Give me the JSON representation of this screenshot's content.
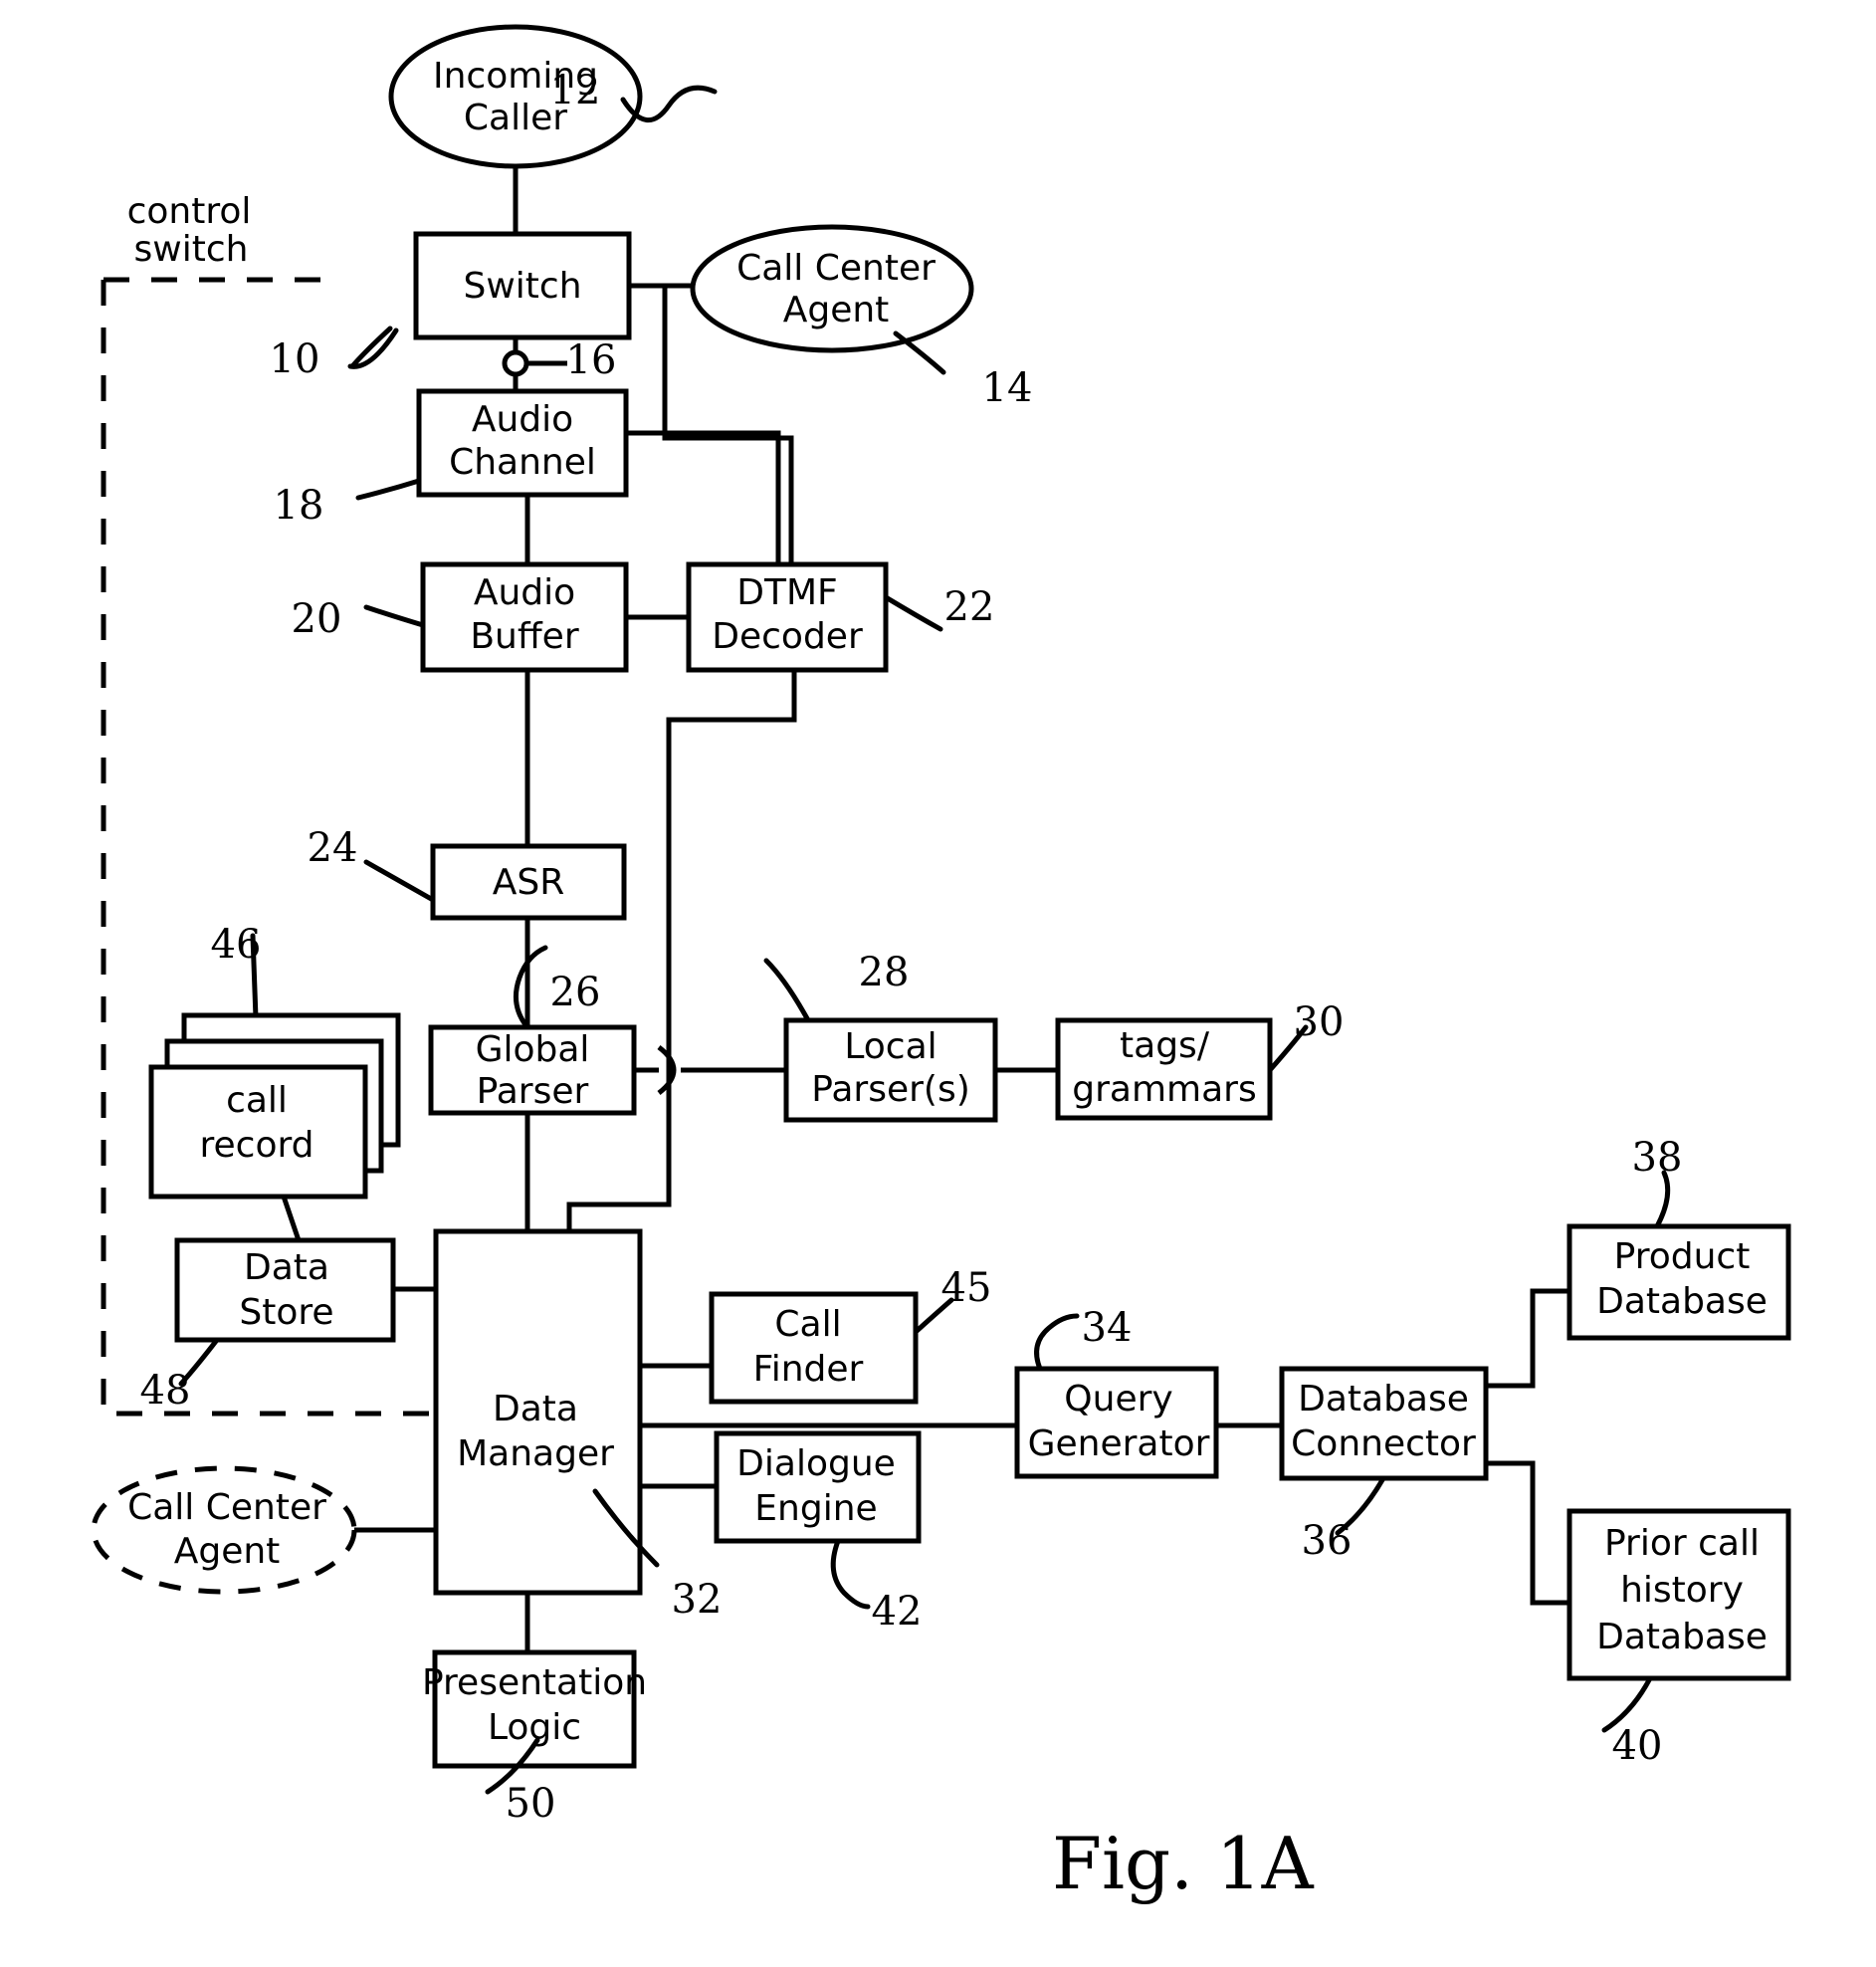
{
  "figure": {
    "caption": "Fig. 1A",
    "control_switch_label_line1": "control",
    "control_switch_label_line2": "switch"
  },
  "nodes": {
    "incoming_caller": {
      "label_line1": "Incoming",
      "label_line2": "Caller",
      "ref": "12"
    },
    "switch": {
      "label": "Switch",
      "ref": "10"
    },
    "call_center_agent_top": {
      "label_line1": "Call Center",
      "label_line2": "Agent",
      "ref": "14"
    },
    "switch_tap": {
      "ref": "16"
    },
    "audio_channel": {
      "label_line1": "Audio",
      "label_line2": "Channel",
      "ref": "18"
    },
    "audio_buffer": {
      "label_line1": "Audio",
      "label_line2": "Buffer",
      "ref": "20"
    },
    "dtmf_decoder": {
      "label_line1": "DTMF",
      "label_line2": "Decoder",
      "ref": "22"
    },
    "asr": {
      "label": "ASR",
      "ref": "24"
    },
    "global_parser": {
      "label_line1": "Global",
      "label_line2": "Parser",
      "ref": "26"
    },
    "local_parsers": {
      "label_line1": "Local",
      "label_line2": "Parser(s)",
      "ref": "28"
    },
    "tags_grammars": {
      "label_line1": "tags/",
      "label_line2": "grammars",
      "ref": "30"
    },
    "call_record": {
      "label_line1": "call",
      "label_line2": "record",
      "ref": "46"
    },
    "data_store": {
      "label_line1": "Data",
      "label_line2": "Store",
      "ref": "48"
    },
    "data_manager": {
      "label_line1": "Data",
      "label_line2": "Manager",
      "ref": "32"
    },
    "call_finder": {
      "label_line1": "Call",
      "label_line2": "Finder",
      "ref": "45"
    },
    "dialogue_engine": {
      "label_line1": "Dialogue",
      "label_line2": "Engine",
      "ref": "42"
    },
    "query_generator": {
      "label_line1": "Query",
      "label_line2": "Generator",
      "ref": "34"
    },
    "database_connector": {
      "label_line1": "Database",
      "label_line2": "Connector",
      "ref": "36"
    },
    "product_database": {
      "label_line1": "Product",
      "label_line2": "Database",
      "ref": "38"
    },
    "prior_call_history_database": {
      "label_line1": "Prior call",
      "label_line2": "history",
      "label_line3": "Database",
      "ref": "40"
    },
    "call_center_agent_bottom": {
      "label_line1": "Call Center",
      "label_line2": "Agent"
    },
    "presentation_logic": {
      "label_line1": "Presentation",
      "label_line2": "Logic",
      "ref": "50"
    }
  },
  "colors": {
    "ink": "#000000",
    "paper": "#ffffff"
  }
}
